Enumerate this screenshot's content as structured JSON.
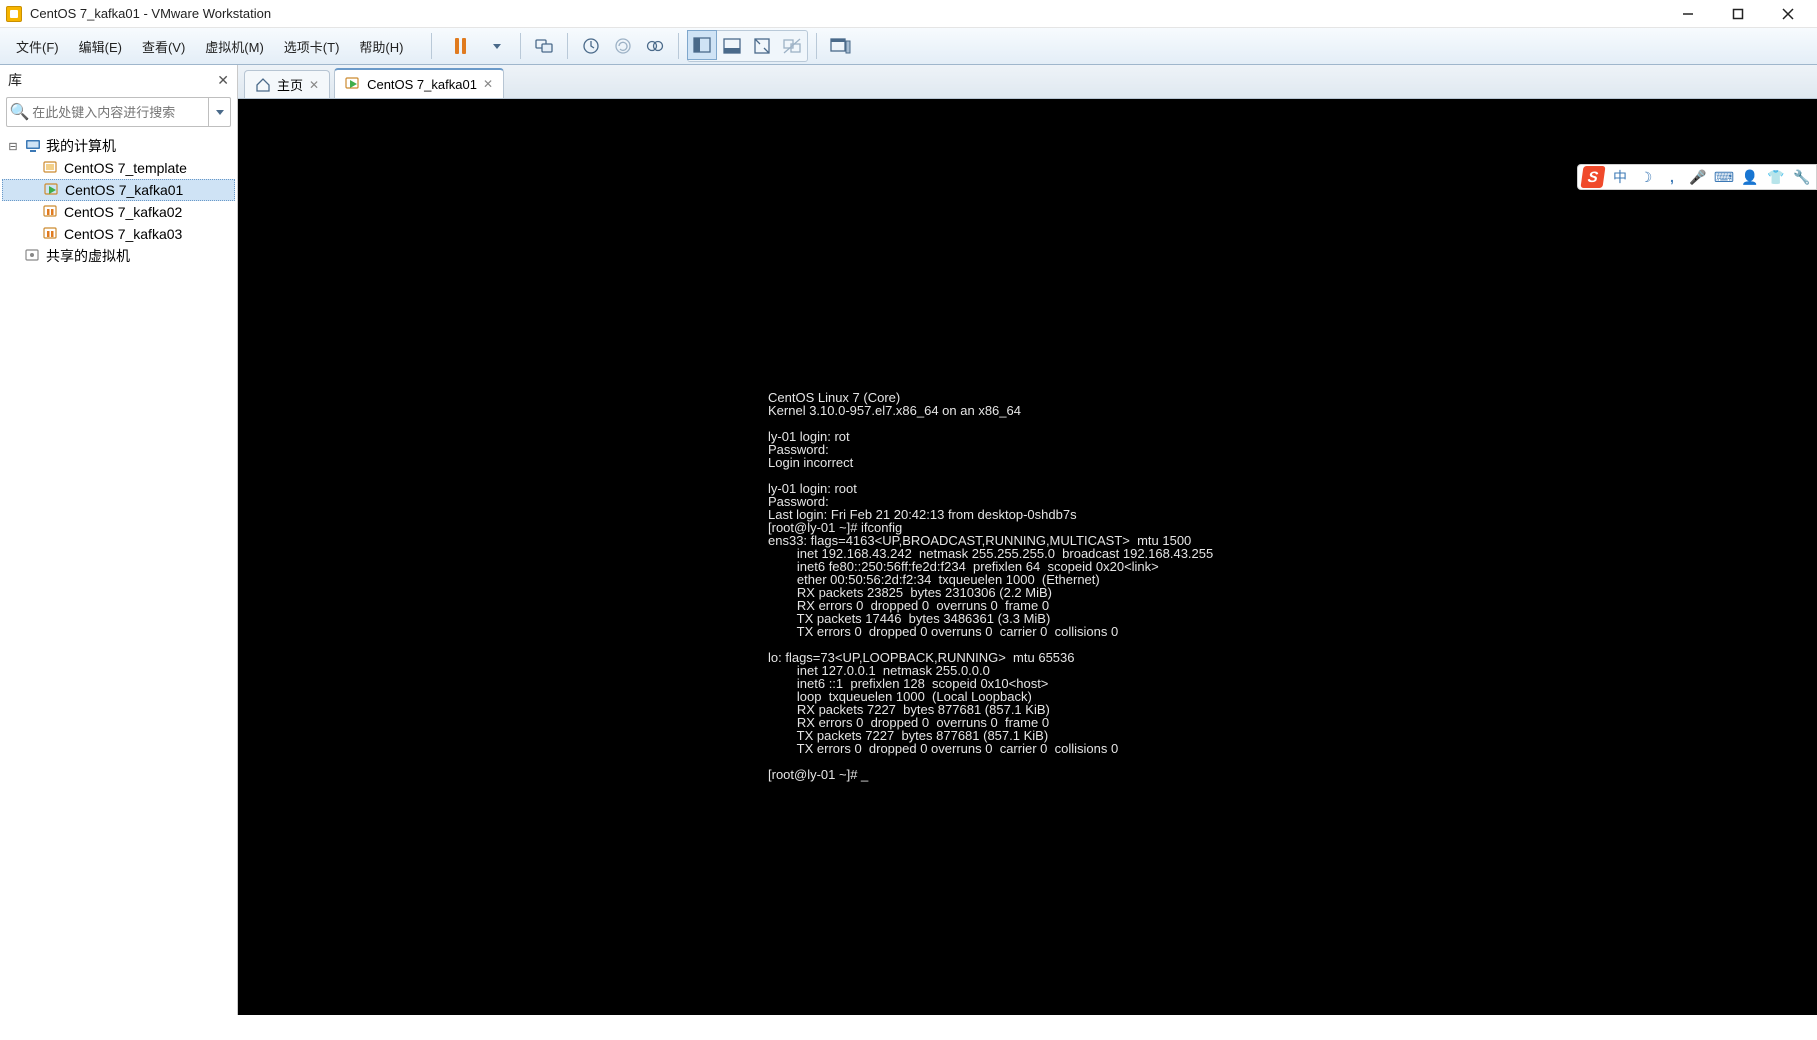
{
  "window": {
    "title": "CentOS 7_kafka01 - VMware Workstation"
  },
  "menu": {
    "items": [
      "文件(F)",
      "编辑(E)",
      "查看(V)",
      "虚拟机(M)",
      "选项卡(T)",
      "帮助(H)"
    ]
  },
  "sidebar": {
    "title": "库",
    "search_placeholder": "在此处键入内容进行搜索",
    "root": "我的计算机",
    "vms": [
      "CentOS 7_template",
      "CentOS 7_kafka01",
      "CentOS 7_kafka02",
      "CentOS 7_kafka03"
    ],
    "shared": "共享的虚拟机"
  },
  "tabs": {
    "home": "主页",
    "vm": "CentOS 7_kafka01"
  },
  "highlight_ip": "192.168.43.242",
  "console": {
    "lines": [
      "CentOS Linux 7 (Core)",
      "Kernel 3.10.0-957.el7.x86_64 on an x86_64",
      "",
      "ly-01 login: rot",
      "Password:",
      "Login incorrect",
      "",
      "ly-01 login: root",
      "Password:",
      "Last login: Fri Feb 21 20:42:13 from desktop-0shdb7s",
      "[root@ly-01 ~]# ifconfig",
      "ens33: flags=4163<UP,BROADCAST,RUNNING,MULTICAST>  mtu 1500",
      "        inet 192.168.43.242  netmask 255.255.255.0  broadcast 192.168.43.255",
      "        inet6 fe80::250:56ff:fe2d:f234  prefixlen 64  scopeid 0x20<link>",
      "        ether 00:50:56:2d:f2:34  txqueuelen 1000  (Ethernet)",
      "        RX packets 23825  bytes 2310306 (2.2 MiB)",
      "        RX errors 0  dropped 0  overruns 0  frame 0",
      "        TX packets 17446  bytes 3486361 (3.3 MiB)",
      "        TX errors 0  dropped 0 overruns 0  carrier 0  collisions 0",
      "",
      "lo: flags=73<UP,LOOPBACK,RUNNING>  mtu 65536",
      "        inet 127.0.0.1  netmask 255.0.0.0",
      "        inet6 ::1  prefixlen 128  scopeid 0x10<host>",
      "        loop  txqueuelen 1000  (Local Loopback)",
      "        RX packets 7227  bytes 877681 (857.1 KiB)",
      "        RX errors 0  dropped 0  overruns 0  frame 0",
      "        TX packets 7227  bytes 877681 (857.1 KiB)",
      "        TX errors 0  dropped 0 overruns 0  carrier 0  collisions 0",
      "",
      "[root@ly-01 ~]# _"
    ]
  },
  "ime": {
    "zh": "中"
  }
}
